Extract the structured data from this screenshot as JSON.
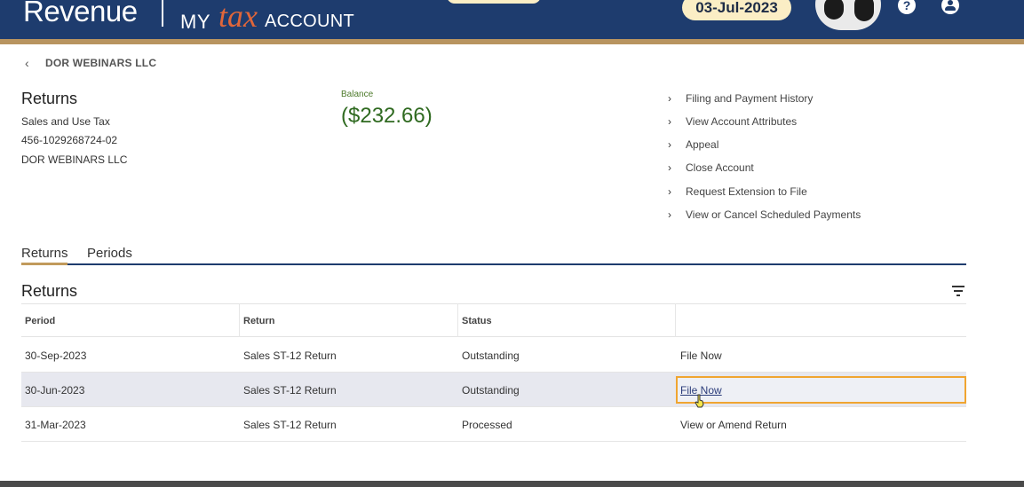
{
  "header": {
    "logo_revenue": "Revenue",
    "logo_my": "MY",
    "logo_tax": "tax",
    "logo_account": "ACCOUNT",
    "date": "03-Jul-2023",
    "help_icon": "?"
  },
  "breadcrumb": {
    "label": "DOR WEBINARS LLC"
  },
  "account": {
    "title": "Returns",
    "tax_type": "Sales and Use Tax",
    "account_id": "456-1029268724-02",
    "business_name": "DOR WEBINARS LLC",
    "balance_label": "Balance",
    "balance_value": "($232.66)"
  },
  "links": [
    {
      "label": "Filing and Payment History"
    },
    {
      "label": "View Account Attributes"
    },
    {
      "label": "Appeal"
    },
    {
      "label": "Close Account"
    },
    {
      "label": "Request Extension to File"
    },
    {
      "label": "View or Cancel Scheduled Payments"
    }
  ],
  "tabs": [
    {
      "label": "Returns",
      "active": true
    },
    {
      "label": "Periods",
      "active": false
    }
  ],
  "returns_section": {
    "title": "Returns",
    "columns": [
      "Period",
      "Return",
      "Status",
      ""
    ],
    "rows": [
      {
        "period": "30-Sep-2023",
        "return": "Sales ST-12 Return",
        "status": "Outstanding",
        "action": "File Now"
      },
      {
        "period": "30-Jun-2023",
        "return": "Sales ST-12 Return",
        "status": "Outstanding",
        "action": "File Now"
      },
      {
        "period": "31-Mar-2023",
        "return": "Sales ST-12 Return",
        "status": "Processed",
        "action": "View or Amend Return"
      }
    ]
  },
  "colors": {
    "header_bg": "#1e3c6e",
    "accent_gold": "#b89460",
    "balance_green": "#2f6a20",
    "focus_orange": "#f0a531"
  }
}
